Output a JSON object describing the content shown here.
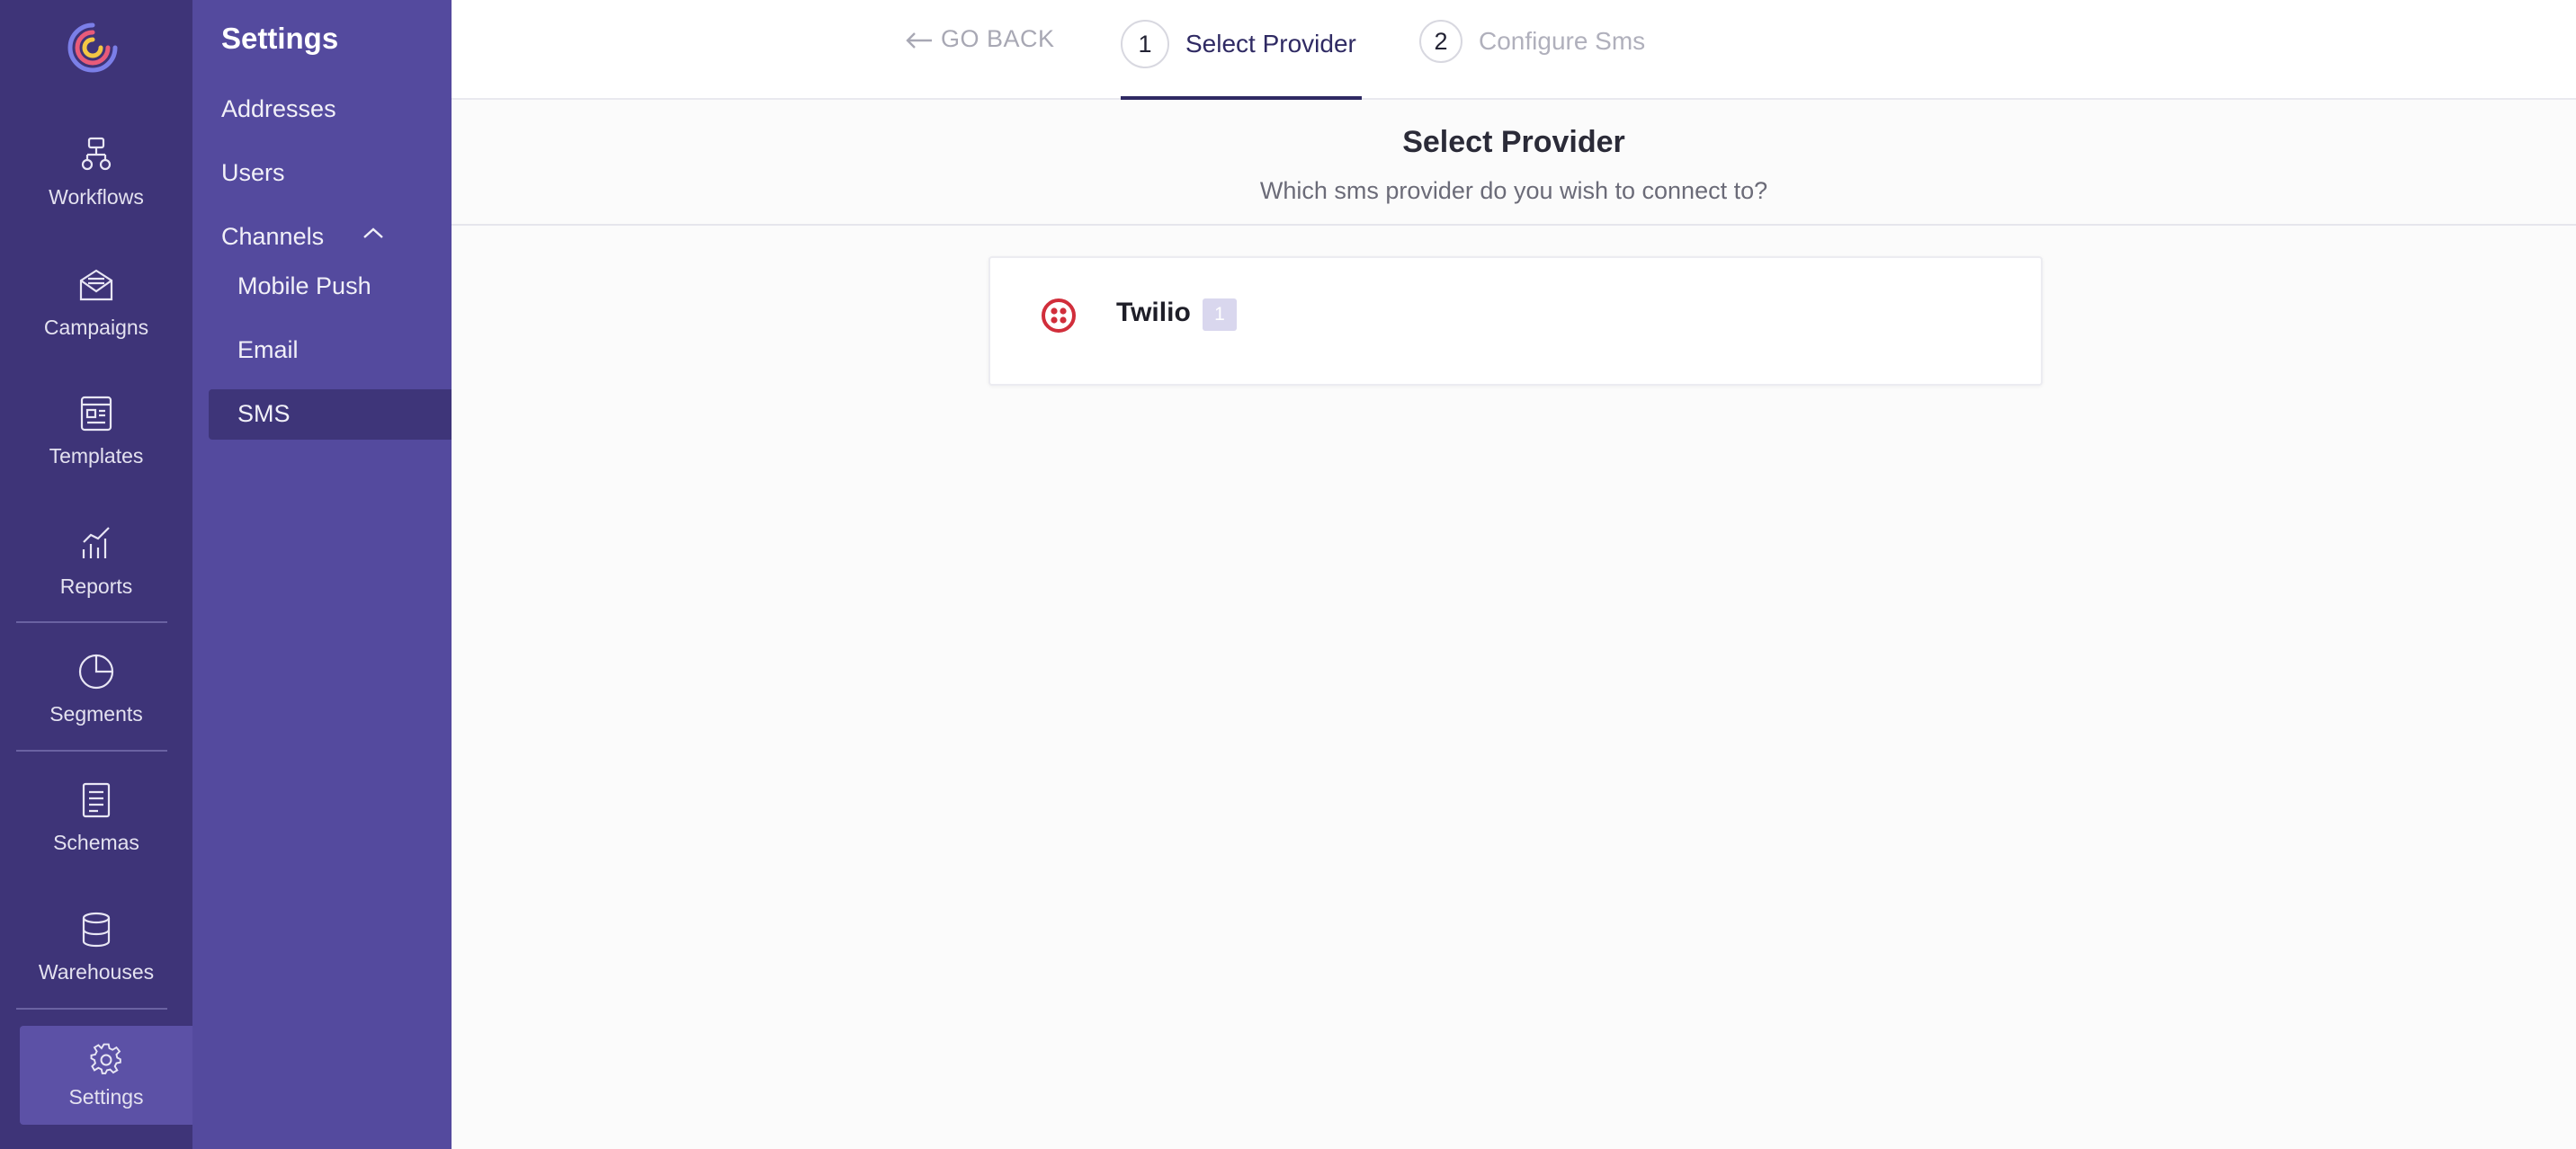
{
  "rail": {
    "items": [
      {
        "label": "Workflows",
        "icon": "workflow-icon"
      },
      {
        "label": "Campaigns",
        "icon": "campaign-icon"
      },
      {
        "label": "Templates",
        "icon": "template-icon"
      },
      {
        "label": "Reports",
        "icon": "reports-icon"
      },
      {
        "label": "Segments",
        "icon": "segments-icon"
      },
      {
        "label": "Schemas",
        "icon": "schemas-icon"
      },
      {
        "label": "Warehouses",
        "icon": "database-icon"
      },
      {
        "label": "Settings",
        "icon": "gear-icon"
      }
    ],
    "active": "Settings"
  },
  "sidebar": {
    "title": "Settings",
    "items": [
      {
        "label": "Addresses"
      },
      {
        "label": "Users"
      },
      {
        "label": "Channels",
        "expanded": true
      }
    ],
    "channels": [
      {
        "label": "Mobile Push"
      },
      {
        "label": "Email"
      },
      {
        "label": "SMS",
        "active": true
      }
    ]
  },
  "steps": {
    "go_back": "GO BACK",
    "items": [
      {
        "number": "1",
        "label": "Select Provider",
        "active": true
      },
      {
        "number": "2",
        "label": "Configure Sms",
        "active": false
      }
    ]
  },
  "heading": {
    "title": "Select Provider",
    "subtitle": "Which sms provider do you wish to connect to?"
  },
  "providers": [
    {
      "name": "Twilio",
      "count": "1",
      "icon": "twilio-icon"
    }
  ],
  "colors": {
    "rail_bg": "#3e3478",
    "sidebar_bg": "#544a9e",
    "active_bg": "#3e3579",
    "accent": "#2f2a63",
    "twilio_red": "#d12e3b"
  }
}
